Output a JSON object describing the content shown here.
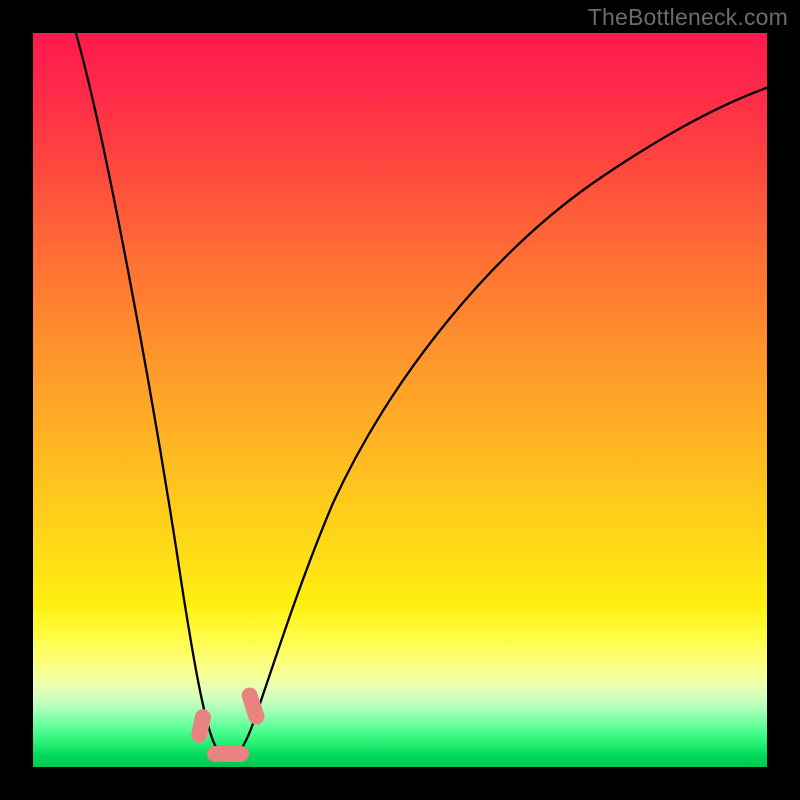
{
  "watermark": "TheBottleneck.com",
  "colors": {
    "background_frame": "#000000",
    "curve_stroke": "#000000",
    "highlight": "#e9837f"
  },
  "chart_data": {
    "type": "line",
    "title": "",
    "xlabel": "",
    "ylabel": "",
    "xlim": [
      0,
      100
    ],
    "ylim": [
      0,
      100
    ],
    "series": [
      {
        "name": "bottleneck-curve",
        "x": [
          6,
          8,
          10,
          12,
          14,
          16,
          18,
          20,
          22,
          23.5,
          25,
          26.5,
          28,
          30,
          34,
          40,
          48,
          56,
          64,
          72,
          80,
          88,
          96,
          100
        ],
        "y": [
          100,
          88,
          76,
          64,
          52,
          40,
          28,
          16,
          8,
          3,
          1,
          3,
          8,
          16,
          30,
          45,
          58,
          67,
          74,
          79,
          83,
          86,
          88.5,
          89.5
        ]
      }
    ],
    "annotations": [
      {
        "name": "left-highlight",
        "x": 22.7,
        "y": 3.8,
        "shape": "capsule"
      },
      {
        "name": "floor-highlight",
        "x": 25.2,
        "y": 0.9,
        "shape": "capsule"
      },
      {
        "name": "right-highlight",
        "x": 28.0,
        "y": 7.0,
        "shape": "capsule"
      }
    ],
    "notes": "V-shaped bottleneck curve over vertical red→yellow→green gradient; minimum near x≈25 at y≈0."
  }
}
